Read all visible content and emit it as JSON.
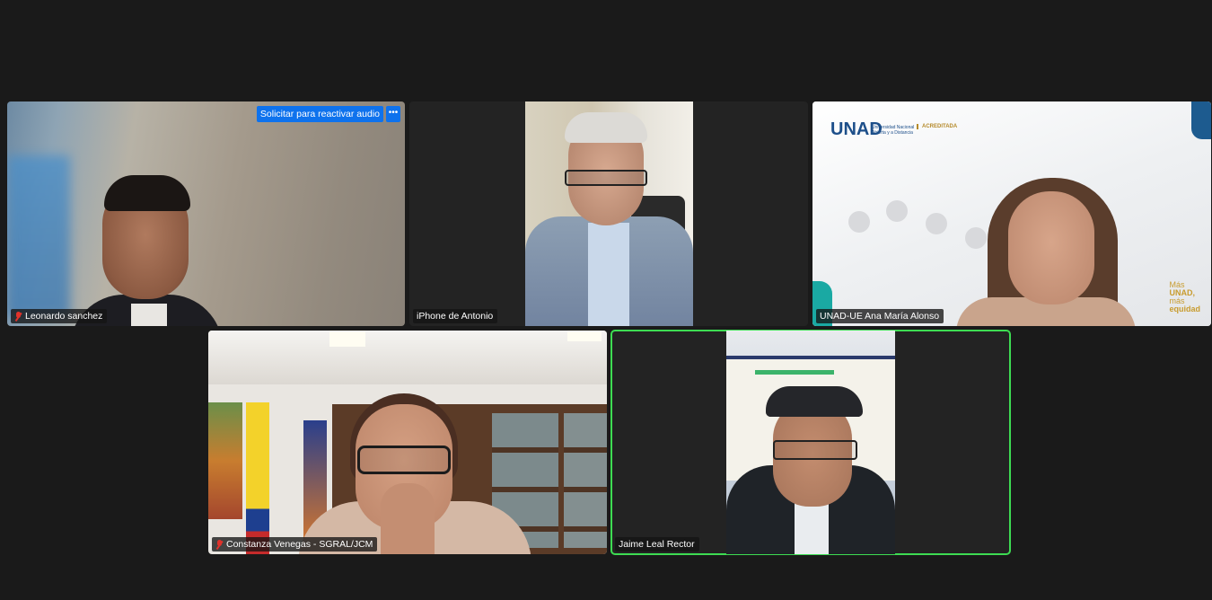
{
  "participants": [
    {
      "name": "Leonardo sanchez",
      "muted": true
    },
    {
      "name": "iPhone de Antonio",
      "muted": false
    },
    {
      "name": "UNAD-UE Ana María Alonso",
      "muted": false
    },
    {
      "name": "Constanza Venegas - SGRAL/JCM",
      "muted": true
    },
    {
      "name": "Jaime Leal Rector",
      "muted": false,
      "speaking": true
    }
  ],
  "tile1": {
    "request_audio_label": "Solicitar para reactivar audio",
    "more_label": "•••"
  },
  "tile3": {
    "logo": "UNAD",
    "logo_sub1": "Universidad Nacional",
    "logo_sub2": "Abierta y a Distancia",
    "badge": "ACREDITADA",
    "slogan_1": "Más",
    "slogan_2": "UNAD,",
    "slogan_3": "más",
    "slogan_4": "equidad"
  },
  "colors": {
    "background": "#1a1a1a",
    "active_speaker": "#3ddc52",
    "button": "#0e72ed",
    "muted_icon": "#e0322b"
  }
}
